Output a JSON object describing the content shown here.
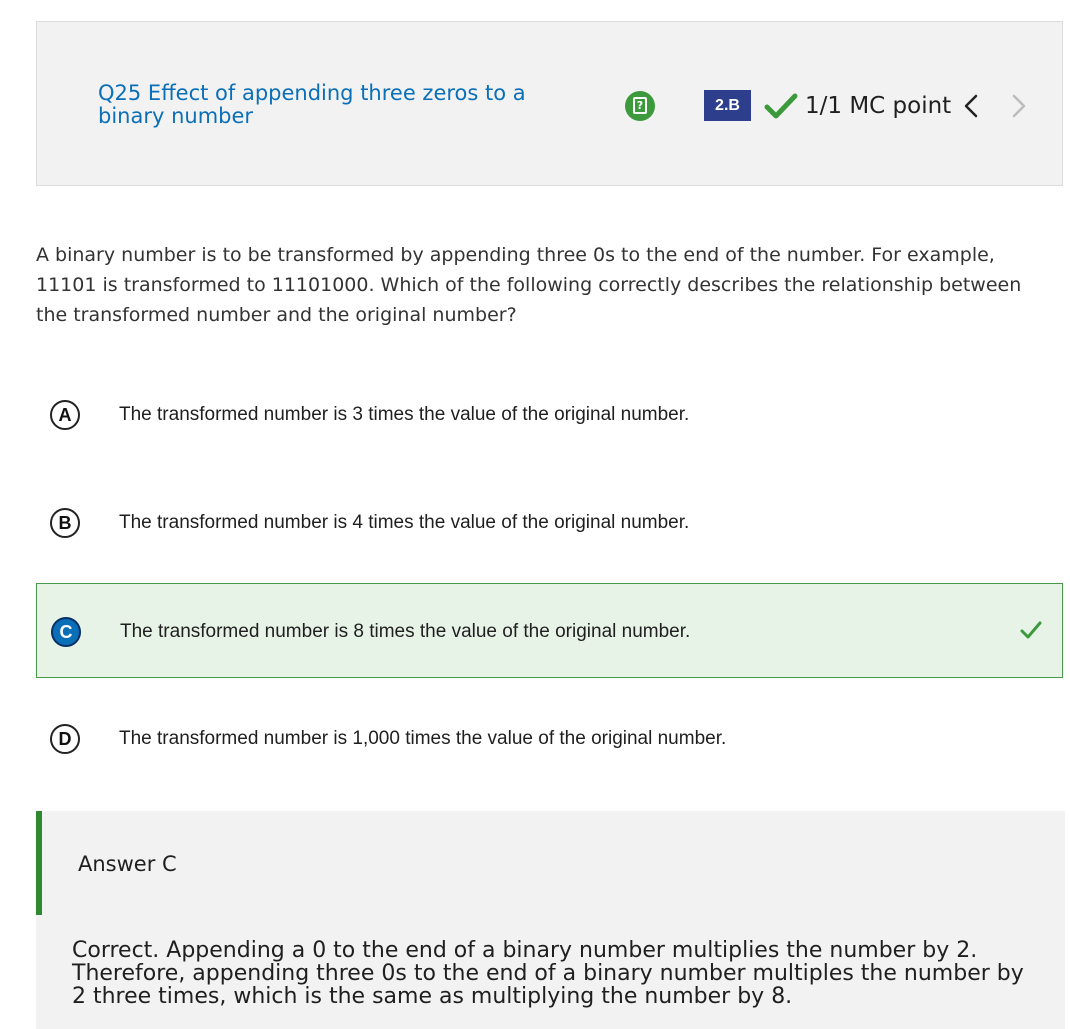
{
  "question": {
    "title": "Q25 Effect of appending three zeros to a binary number",
    "help_icon": "help-note-icon",
    "skill_badge": "2.B",
    "score": "1/1 MC point",
    "stem": "A binary number is to be transformed by appending three 0s to the end of the number. For example, 11101 is transformed to 11101000. Which of the following correctly describes the relationship between the transformed number and the original number?"
  },
  "choices": [
    {
      "letter": "A",
      "text": "The transformed number is 3 times the value of the original number."
    },
    {
      "letter": "B",
      "text": "The transformed number is 4 times the value of the original number."
    },
    {
      "letter": "C",
      "text": "The transformed number is 8 times the value of the original number.",
      "selected": true,
      "correct": true
    },
    {
      "letter": "D",
      "text": "The transformed number is 1,000 times the value of the original number."
    }
  ],
  "answer": {
    "label": "Answer C",
    "explanation": "Correct. Appending a 0 to the end of a binary number multiplies the number by 2. Therefore, appending three 0s to the end of a binary number multiples the number by 2 three times, which is the same as multiplying the number by 8."
  },
  "colors": {
    "title_blue": "#0b6fb8",
    "badge_navy": "#2c3e8c",
    "correct_green": "#3c9a3c",
    "selected_bg": "#e8f3e8"
  }
}
